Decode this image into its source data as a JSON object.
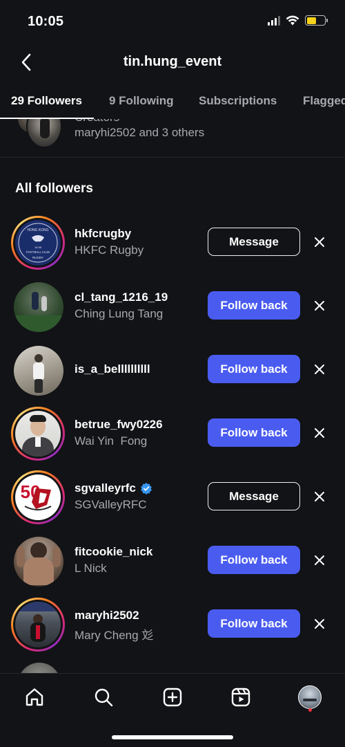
{
  "status_bar": {
    "time": "10:05"
  },
  "header": {
    "title": "tin.hung_event"
  },
  "tabs": [
    {
      "label": "29 Followers",
      "active": true
    },
    {
      "label": "9 Following",
      "active": false
    },
    {
      "label": "Subscriptions",
      "active": false
    },
    {
      "label": "Flagged",
      "active": false
    }
  ],
  "creators": {
    "heading": "Creators",
    "subtitle": "maryhi2502 and 3 others"
  },
  "section": {
    "title": "All followers"
  },
  "followers": [
    {
      "username": "hkfcrugby",
      "fullname": "HKFC Rugby",
      "action": "Message",
      "story": true,
      "verified": false
    },
    {
      "username": "cl_tang_1216_19",
      "fullname": "Ching Lung Tang",
      "action": "Follow back",
      "story": false,
      "verified": false
    },
    {
      "username": "is_a_bellllllllll",
      "fullname": "",
      "action": "Follow back",
      "story": false,
      "verified": false
    },
    {
      "username": "betrue_fwy0226",
      "fullname": "Wai Yin  Fong",
      "action": "Follow back",
      "story": true,
      "verified": false
    },
    {
      "username": "sgvalleyrfc",
      "fullname": "SGValleyRFC",
      "action": "Message",
      "story": true,
      "verified": true
    },
    {
      "username": "fitcookie_nick",
      "fullname": "L Nick",
      "action": "Follow back",
      "story": false,
      "verified": false
    },
    {
      "username": "maryhi2502",
      "fullname": "Mary Cheng 彣",
      "action": "Follow back",
      "story": true,
      "verified": false
    }
  ],
  "avatar_texts": {
    "hkfc_top": "HONG KONG",
    "hkfc_mid": "FOOTBALL CLUB",
    "hkfc_bottom": "RUGBY",
    "hkfc_year": "18 86",
    "sgv_number": "50"
  },
  "colors": {
    "background": "#121316",
    "follow_button": "#4a5cf0",
    "verified": "#3797f0",
    "battery": "#f6d21a",
    "notification_dot": "#ff3040"
  },
  "bottom_nav": [
    "home-icon",
    "search-icon",
    "create-icon",
    "reels-icon",
    "profile-avatar"
  ]
}
